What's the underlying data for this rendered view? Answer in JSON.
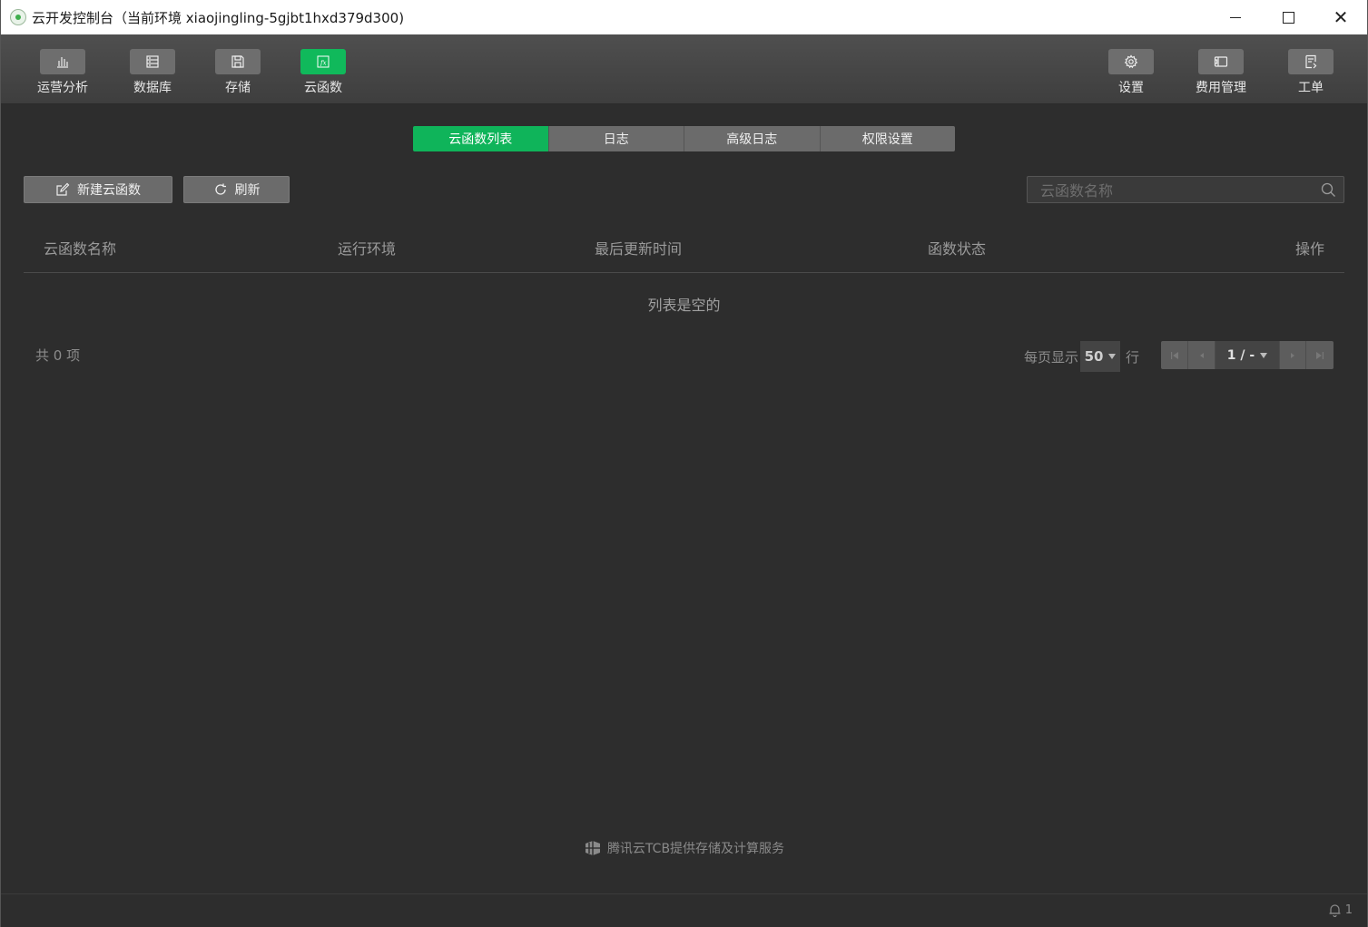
{
  "window": {
    "title": "云开发控制台（当前环境 xiaojingling-5gjbt1hxd379d300)"
  },
  "toolbar": {
    "left": [
      {
        "label": "运营分析",
        "icon": "bar-chart-icon"
      },
      {
        "label": "数据库",
        "icon": "database-icon"
      },
      {
        "label": "存储",
        "icon": "storage-icon"
      },
      {
        "label": "云函数",
        "icon": "function-icon",
        "active": true
      }
    ],
    "right": [
      {
        "label": "设置",
        "icon": "gear-icon"
      },
      {
        "label": "费用管理",
        "icon": "wallet-icon"
      },
      {
        "label": "工单",
        "icon": "ticket-icon"
      }
    ]
  },
  "tabs": [
    {
      "label": "云函数列表",
      "active": true
    },
    {
      "label": "日志"
    },
    {
      "label": "高级日志"
    },
    {
      "label": "权限设置"
    }
  ],
  "actions": {
    "new_label": "新建云函数",
    "refresh_label": "刷新"
  },
  "search": {
    "placeholder": "云函数名称",
    "value": ""
  },
  "table": {
    "columns": [
      "云函数名称",
      "运行环境",
      "最后更新时间",
      "函数状态",
      "操作"
    ],
    "rows": [],
    "empty_text": "列表是空的"
  },
  "pagination": {
    "total_text": "共 0 项",
    "per_page_prefix": "每页显示",
    "per_page_value": "50",
    "per_page_suffix": "行",
    "page_text": "1 / -"
  },
  "footer": {
    "text": "腾讯云TCB提供存储及计算服务"
  },
  "statusbar": {
    "notification_count": "1"
  },
  "colors": {
    "accent": "#0fb45a",
    "background": "#2d2d2d",
    "toolbar": "#474747"
  }
}
